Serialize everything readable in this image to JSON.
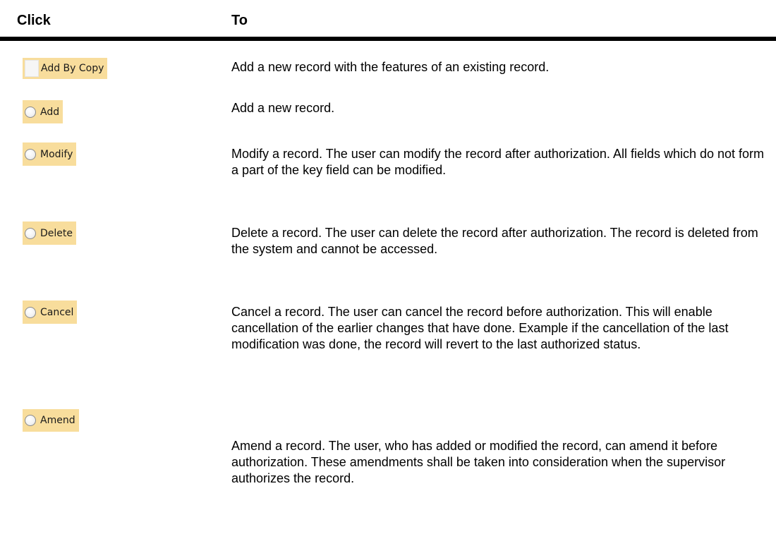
{
  "table": {
    "headers": {
      "click": "Click",
      "to": "To"
    },
    "rows": [
      {
        "button_label": "Add By Copy",
        "control": "checkbox",
        "description": "Add a new record with the features of an existing record."
      },
      {
        "button_label": "Add",
        "control": "radio",
        "description": "Add a new record."
      },
      {
        "button_label": "Modify",
        "control": "radio",
        "description": "Modify a record. The user can modify the record after authorization. All fields which do not form a part of the key field can be modified."
      },
      {
        "button_label": "Delete",
        "control": "radio",
        "description": "Delete a record. The user can delete the record after authorization. The record is deleted from the system and cannot be accessed."
      },
      {
        "button_label": "Cancel",
        "control": "radio",
        "description": "Cancel a record. The user can cancel the record before authorization. This will enable cancellation of the earlier changes that have done. Example if the cancellation of the last modification was done, the record will revert to the last authorized status."
      },
      {
        "button_label": "Amend",
        "control": "radio",
        "description": "Amend a record. The user, who has added or modified the record, can amend it before authorization. These amendments shall be taken into consideration when the supervisor authorizes the record."
      }
    ]
  },
  "colors": {
    "button_highlight": "#f8dd9c",
    "rule": "#000000"
  }
}
